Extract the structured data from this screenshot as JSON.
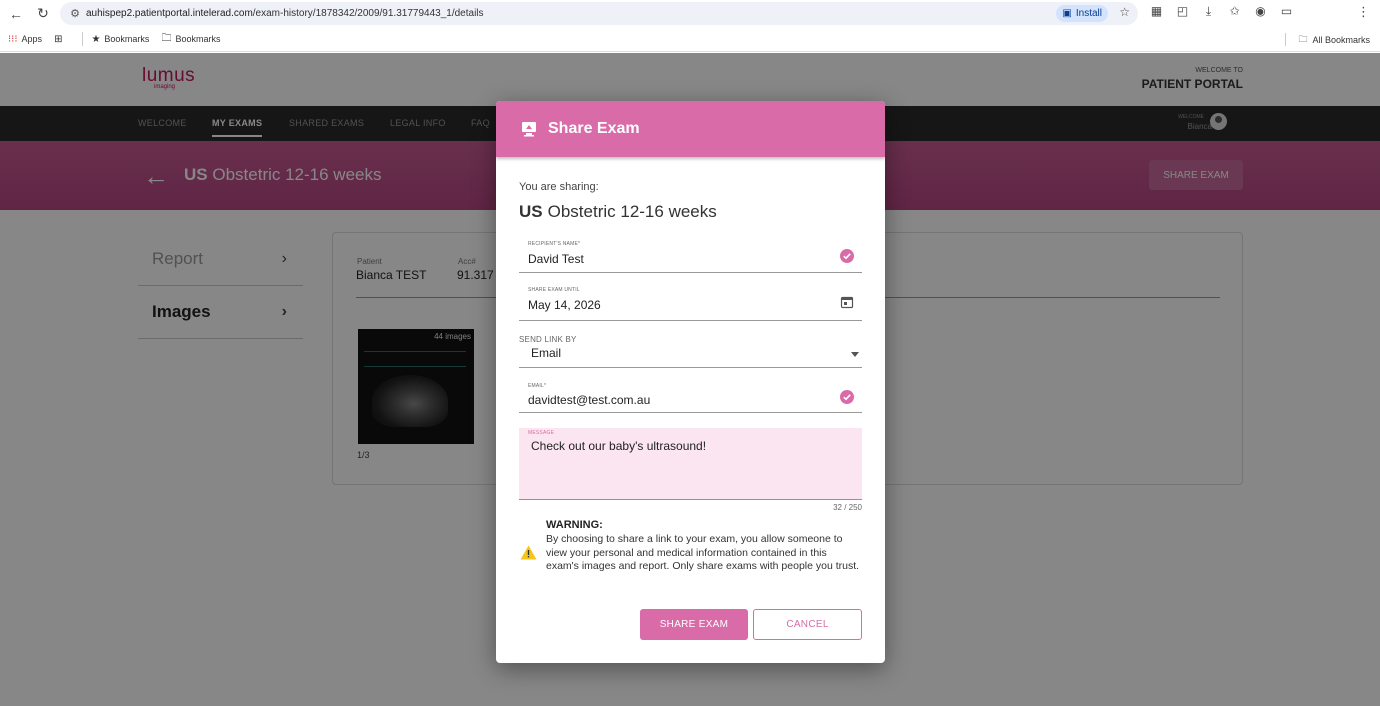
{
  "browser": {
    "url_host": "auhispep2.patientportal.intelerad.com",
    "url_path": "/exam-history/1878342/2009/91.31779443_1/details",
    "install_label": "Install",
    "bookmarks": {
      "apps_label": "Apps",
      "item1_label": "Bookmarks",
      "item2_label": "Bookmarks",
      "all_label": "All Bookmarks"
    }
  },
  "site": {
    "logo_text": "lumus",
    "logo_sub": "imaging",
    "welcome_to": "WELCOME TO",
    "portal_title": "PATIENT PORTAL"
  },
  "nav": {
    "items": [
      "WELCOME",
      "MY EXAMS",
      "SHARED EXAMS",
      "LEGAL INFO",
      "FAQ"
    ],
    "active_index": 1,
    "welcome_small": "WELCOME",
    "user_name": "Bianca"
  },
  "banner": {
    "modality": "US",
    "exam_name": "Obstetric 12-16 weeks",
    "share_button": "SHARE EXAM"
  },
  "side_menu": [
    {
      "label": "Report",
      "active": false
    },
    {
      "label": "Images",
      "active": true
    }
  ],
  "card": {
    "patient_label": "Patient",
    "patient_value": "Bianca TEST",
    "acc_label": "Acc#",
    "acc_value": "91.317",
    "thumb_count": "44 images",
    "page_indicator": "1/3"
  },
  "modal": {
    "title": "Share Exam",
    "sharing_label": "You are sharing:",
    "exam_modality": "US",
    "exam_name": "Obstetric 12-16 weeks",
    "recipient_label": "RECIPIENT'S NAME*",
    "recipient_value": "David Test",
    "until_label": "SHARE EXAM UNTIL",
    "until_value": "May 14, 2026",
    "send_label": "Send link by",
    "send_value": "Email",
    "email_label": "EMAIL*",
    "email_value": "davidtest@test.com.au",
    "message_label": "MESSAGE",
    "message_value": "Check out our baby's ultrasound!",
    "message_count": "32 / 250",
    "warning_title": "WARNING:",
    "warning_body": "By choosing to share a link to your exam, you allow someone to view your personal and medical information contained in this exam's images and report. Only share exams with people you trust.",
    "share_button": "SHARE EXAM",
    "cancel_button": "CANCEL"
  },
  "colors": {
    "accent": "#d96ca8",
    "banner": "#b64683",
    "nav_bg": "#2b2b2b",
    "logo": "#c2185b",
    "warning": "#f5c518"
  }
}
